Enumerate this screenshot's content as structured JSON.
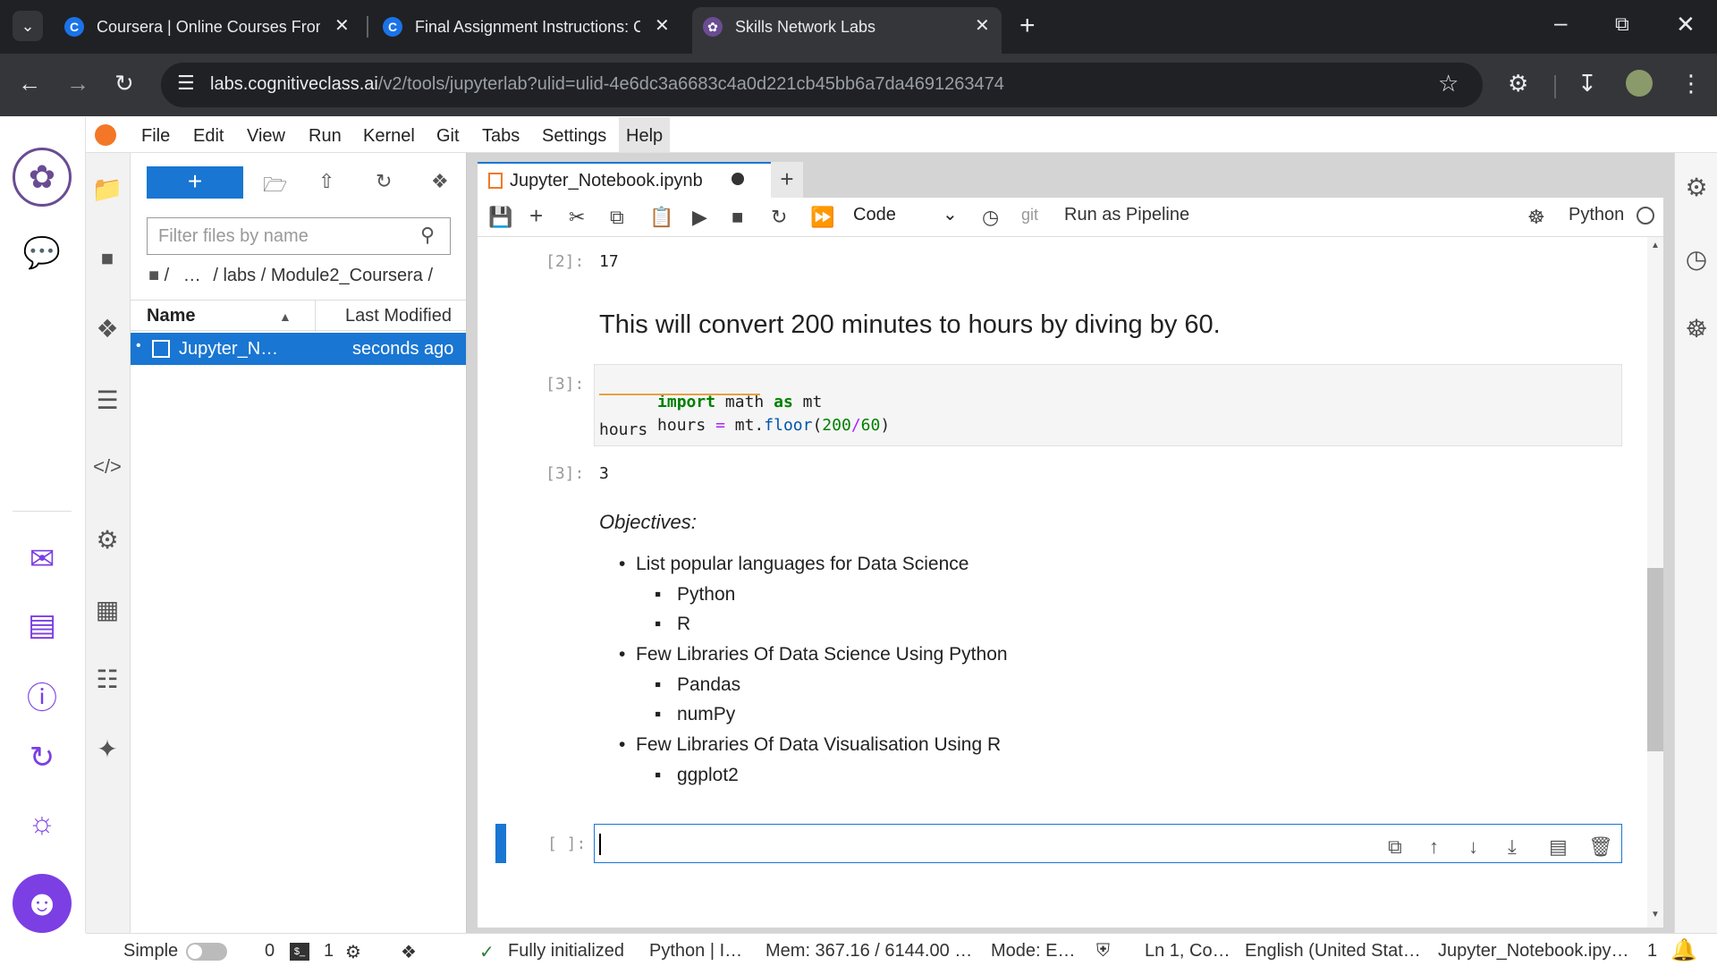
{
  "browser": {
    "tabs": [
      {
        "title": "Coursera | Online Courses From",
        "icon": "coursera-icon"
      },
      {
        "title": "Final Assignment Instructions: C",
        "icon": "coursera-icon"
      },
      {
        "title": "Skills Network Labs",
        "icon": "skills-network-icon"
      }
    ],
    "new_tab": "+",
    "url_domain": "labs.cognitiveclass.ai",
    "url_path": "/v2/tools/jupyterlab?ulid=ulid-4e6dc3a6683c4a0d221cb45bb6a7da4691263474"
  },
  "menu": [
    "File",
    "Edit",
    "View",
    "Run",
    "Kernel",
    "Git",
    "Tabs",
    "Settings",
    "Help"
  ],
  "filebrowser": {
    "new_label": "+",
    "filter_placeholder": "Filter files by name",
    "breadcrumb_root": "/",
    "breadcrumb_ellipsis": "…",
    "breadcrumb_path": "/ labs / Module2_Coursera /",
    "col_name": "Name",
    "col_modified": "Last Modified",
    "file_name": "Jupyter_N…",
    "file_modified": "seconds ago"
  },
  "notebook": {
    "tab_title": "Jupyter_Notebook.ipynb",
    "add_tab": "+",
    "cell_type": "Code",
    "git_label": "git",
    "pipeline_label": "Run as Pipeline",
    "kernel_name": "Python",
    "out2_prompt": "[2]:",
    "out2_value": "17",
    "heading": "This will convert 200 minutes to hours by diving by 60.",
    "in3_prompt": "[3]:",
    "code_line1_kw1": "import",
    "code_line1_mod": "math",
    "code_line1_kw2": "as",
    "code_line1_alias": "mt",
    "code_line2_var": "hours",
    "code_line2_eq": "=",
    "code_line2_obj": "mt.",
    "code_line2_fn": "floor",
    "code_line2_open": "(",
    "code_line2_n1": "200",
    "code_line2_div": "/",
    "code_line2_n2": "60",
    "code_line2_close": ")",
    "code_line3": "hours",
    "out3_prompt": "[3]:",
    "out3_value": "3",
    "objectives_title": "Objectives:",
    "bullets": [
      "List popular languages for Data Science",
      "Python",
      "R",
      "Few Libraries Of Data Science Using Python",
      "Pandas",
      "numPy",
      "Few Libraries Of Data Visualisation Using R",
      "ggplot2"
    ],
    "empty_prompt": "[ ]:"
  },
  "status": {
    "simple": "Simple",
    "terminals": "0",
    "kernels": "1",
    "init": "Fully initialized",
    "kernel": "Python | I…",
    "mem": "Mem: 367.16 / 6144.00 …",
    "mode": "Mode: E…",
    "position": "Ln 1, Co…",
    "language": "English (United Stat…",
    "file": "Jupyter_Notebook.ipy…",
    "notifications": "1"
  },
  "colors": {
    "accent": "#1976d2",
    "purple": "#7b3fe4",
    "keyword": "#008000"
  }
}
